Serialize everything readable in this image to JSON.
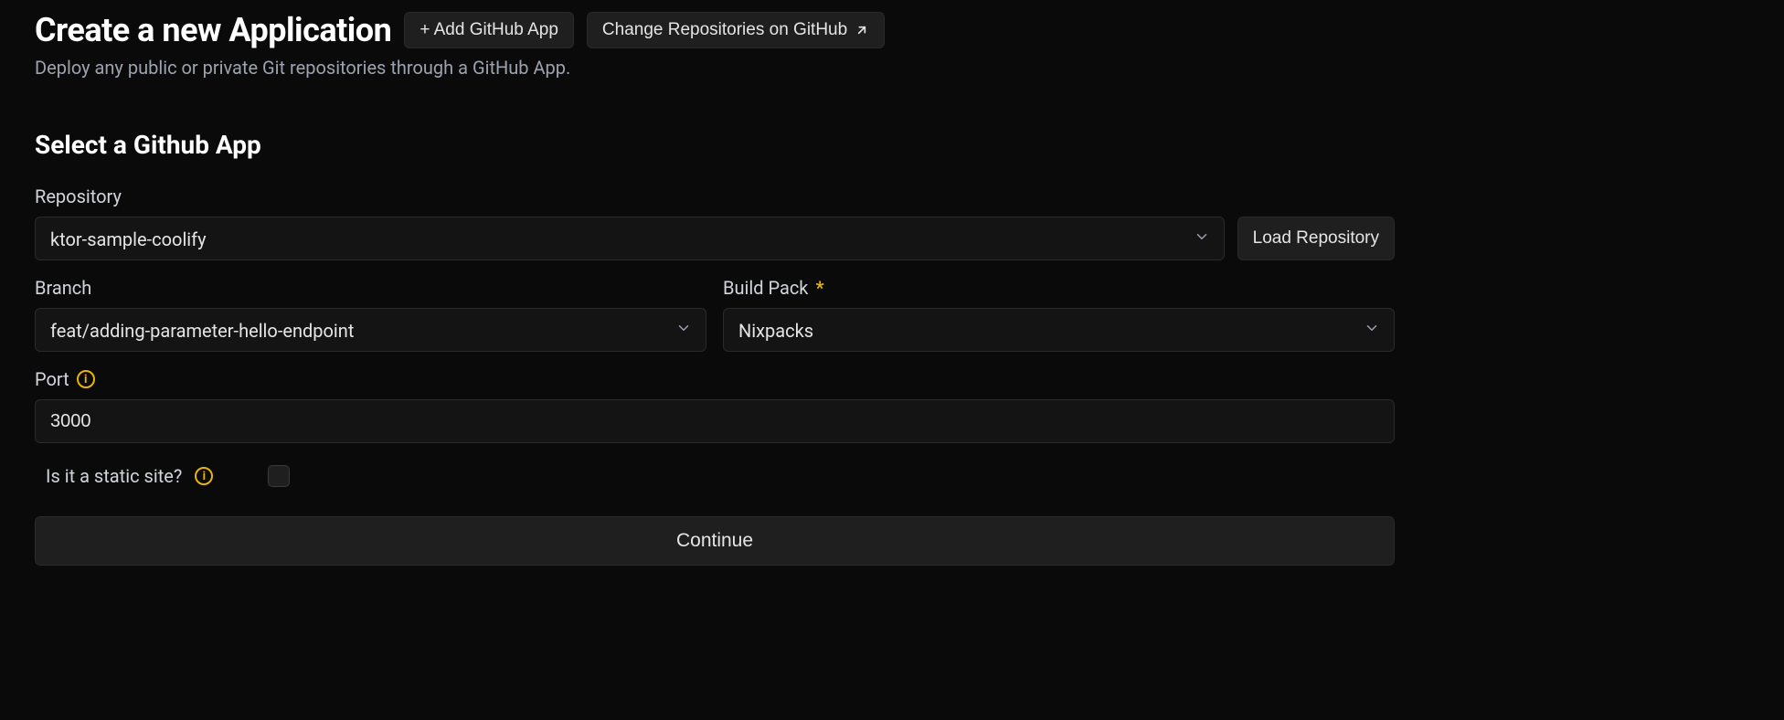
{
  "header": {
    "title": "Create a new Application",
    "add_app_label": "+ Add GitHub App",
    "change_repos_label": "Change Repositories on GitHub",
    "subtitle": "Deploy any public or private Git repositories through a GitHub App."
  },
  "section": {
    "title": "Select a Github App"
  },
  "form": {
    "repository_label": "Repository",
    "repository_value": "ktor-sample-coolify",
    "load_repo_label": "Load Repository",
    "branch_label": "Branch",
    "branch_value": "feat/adding-parameter-hello-endpoint",
    "build_pack_label": "Build Pack",
    "build_pack_required": "*",
    "build_pack_value": "Nixpacks",
    "port_label": "Port",
    "port_value": "3000",
    "static_label": "Is it a static site?",
    "continue_label": "Continue"
  }
}
